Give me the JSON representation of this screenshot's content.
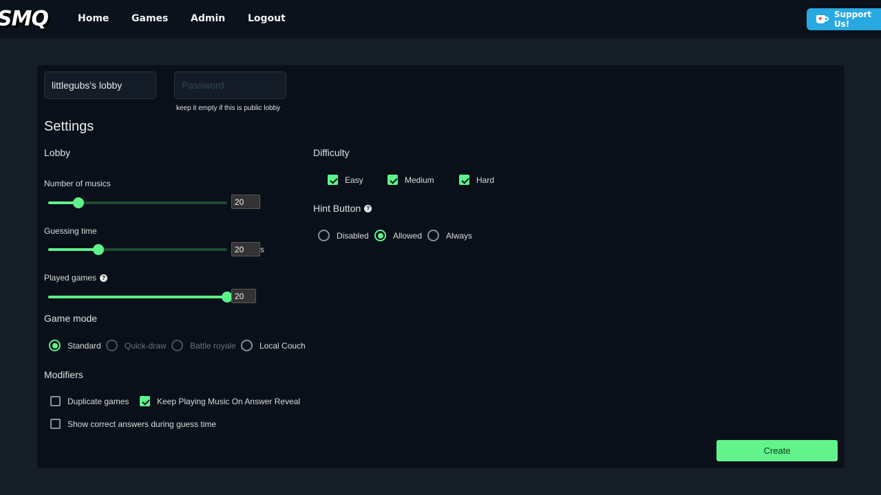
{
  "navbar": {
    "logo": "SMQ",
    "links": [
      "Home",
      "Games",
      "Admin",
      "Logout"
    ],
    "support_label": "Support Us!",
    "support_color": "#29a9e1"
  },
  "lobby": {
    "name_value": "littlegubs's lobby",
    "password_value": "",
    "password_placeholder": "Password",
    "password_hint": "keep it empty if this is public lobby"
  },
  "settings": {
    "title": "Settings",
    "lobby_label": "Lobby",
    "sliders": [
      {
        "label": "Number of musics",
        "value": "20",
        "fraction": 0.17,
        "unit": "",
        "help": false
      },
      {
        "label": "Guessing time",
        "value": "20",
        "fraction": 0.28,
        "unit": "s",
        "help": false
      },
      {
        "label": "Played games",
        "value": "20",
        "fraction": 1.0,
        "unit": "",
        "help": true
      }
    ],
    "game_mode": {
      "label": "Game mode",
      "options": [
        {
          "label": "Standard",
          "selected": true,
          "disabled": false
        },
        {
          "label": "Quick-draw",
          "selected": false,
          "disabled": true
        },
        {
          "label": "Battle royale",
          "selected": false,
          "disabled": true
        },
        {
          "label": "Local Couch",
          "selected": false,
          "disabled": false
        }
      ]
    },
    "modifiers": {
      "label": "Modifiers",
      "options": [
        {
          "label": "Duplicate games",
          "checked": false
        },
        {
          "label": "Keep Playing Music On Answer Reveal",
          "checked": true
        },
        {
          "label": "Show correct answers during guess time",
          "checked": false
        }
      ]
    },
    "difficulty": {
      "label": "Difficulty",
      "options": [
        {
          "label": "Easy",
          "checked": true
        },
        {
          "label": "Medium",
          "checked": true
        },
        {
          "label": "Hard",
          "checked": true
        }
      ]
    },
    "hint_button": {
      "label": "Hint Button",
      "options": [
        {
          "label": "Disabled",
          "selected": false
        },
        {
          "label": "Allowed",
          "selected": true
        },
        {
          "label": "Always",
          "selected": false
        }
      ]
    },
    "help_glyph": "?"
  },
  "create_label": "Create",
  "accent_color": "#5ef28b"
}
